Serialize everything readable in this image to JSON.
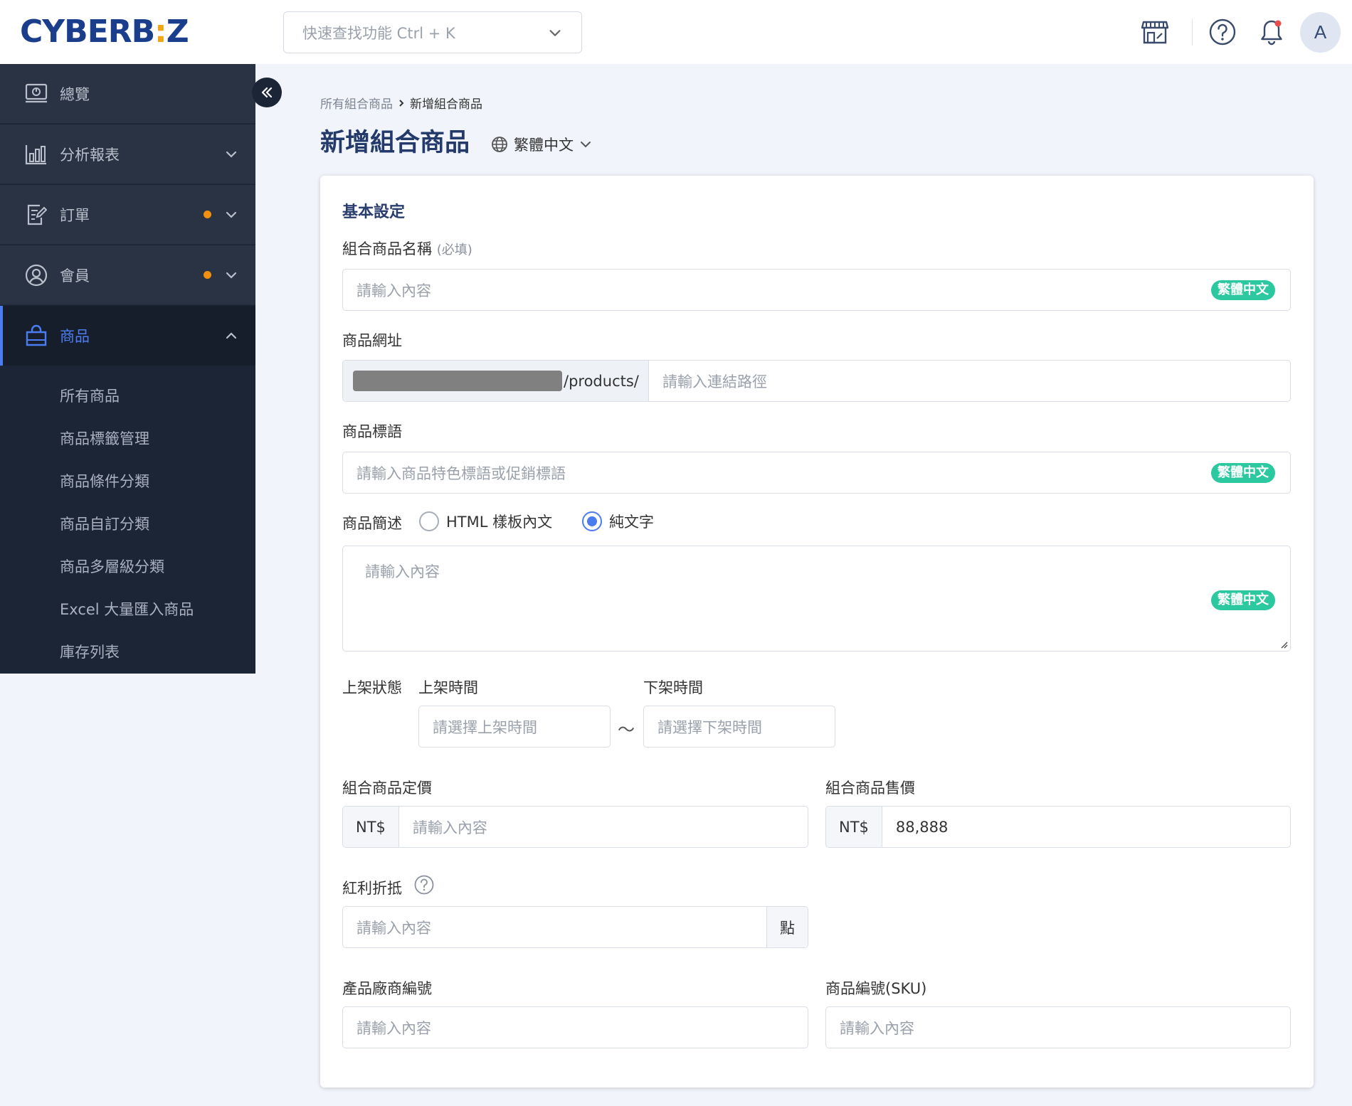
{
  "brand": {
    "logo_text_1": "CYBERB",
    "logo_dot": ":",
    "logo_text_2": "Z"
  },
  "header": {
    "search_placeholder": "快速查找功能 Ctrl + K",
    "avatar_letter": "A",
    "icons": [
      "storefront-icon",
      "help-circle-icon",
      "bell-icon"
    ]
  },
  "sidebar": {
    "items": [
      {
        "label": "總覽",
        "icon": "dashboard-icon"
      },
      {
        "label": "分析報表",
        "icon": "bar-chart-icon"
      },
      {
        "label": "訂單",
        "icon": "order-edit-icon"
      },
      {
        "label": "會員",
        "icon": "user-circle-icon"
      },
      {
        "label": "商品",
        "icon": "shopping-bag-icon"
      }
    ],
    "sub_items": [
      "所有商品",
      "商品標籤管理",
      "商品條件分類",
      "商品自訂分類",
      "商品多層級分類",
      "Excel 大量匯入商品",
      "庫存列表"
    ]
  },
  "breadcrumb": {
    "parent": "所有組合商品",
    "current": "新增組合商品"
  },
  "page": {
    "title": "新增組合商品",
    "language": "繁體中文"
  },
  "form": {
    "section_title": "基本設定",
    "lang_badge": "繁體中文",
    "name_label": "組合商品名稱",
    "name_required": "(必填)",
    "name_placeholder": "請輸入內容",
    "url_label": "商品網址",
    "url_suffix": "/products/",
    "url_placeholder": "請輸入連結路徑",
    "tagline_label": "商品標語",
    "tagline_placeholder": "請輸入商品特色標語或促銷標語",
    "desc_label": "商品簡述",
    "desc_option_html": "HTML 樣板內文",
    "desc_option_text": "純文字",
    "desc_placeholder": "請輸入內容",
    "status_label": "上架狀態",
    "start_label": "上架時間",
    "start_placeholder": "請選擇上架時間",
    "tilde": "～",
    "end_label": "下架時間",
    "end_placeholder": "請選擇下架時間",
    "list_price_label": "組合商品定價",
    "currency": "NT$",
    "list_price_placeholder": "請輸入內容",
    "sale_price_label": "組合商品售價",
    "sale_price_value": "88,888",
    "bonus_label": "紅利折抵",
    "bonus_placeholder": "請輸入內容",
    "bonus_unit": "點",
    "vendor_code_label": "產品廠商編號",
    "vendor_code_placeholder": "請輸入內容",
    "sku_label": "商品編號(SKU)",
    "sku_placeholder": "請輸入內容"
  },
  "colors": {
    "brand_blue": "#1a3e8c",
    "accent": "#4c7df0",
    "badge_green": "#2cc8a0",
    "dot_orange": "#f0900e",
    "sidebar_bg": "#1c2536"
  }
}
